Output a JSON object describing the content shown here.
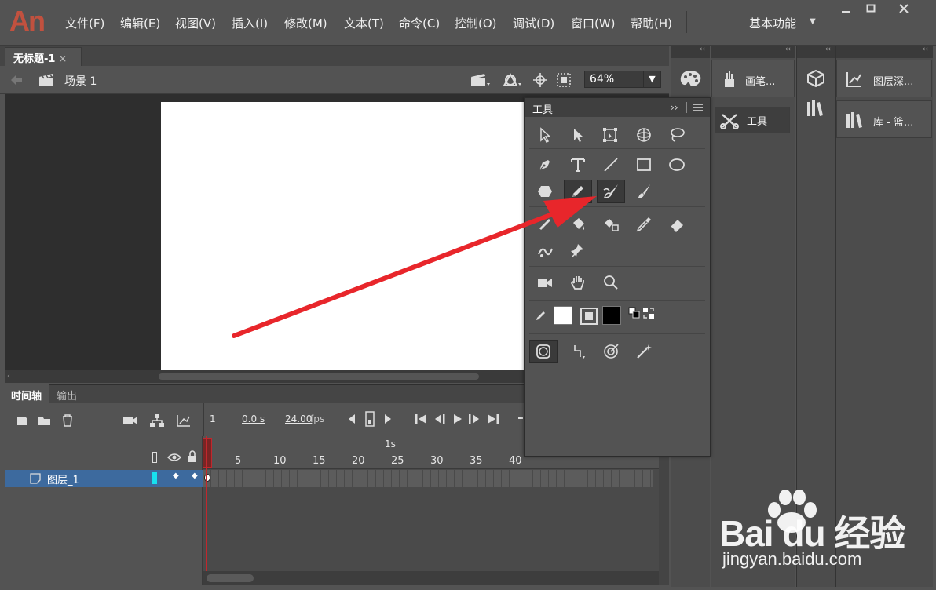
{
  "app": {
    "logo": "An",
    "workspace": "基本功能"
  },
  "menu": [
    "文件(F)",
    "编辑(E)",
    "视图(V)",
    "插入(I)",
    "修改(M)",
    "文本(T)",
    "命令(C)",
    "控制(O)",
    "调试(D)",
    "窗口(W)",
    "帮助(H)"
  ],
  "document": {
    "tab_title": "无标题-1",
    "close": "×",
    "scene": "场景 1",
    "zoom": "64%"
  },
  "timeline": {
    "tab_timeline": "时间轴",
    "tab_output": "输出",
    "current_frame": "1",
    "time": "0.0 s",
    "fps": "24.00",
    "fps_unit": "fps",
    "ruler_marker": "1s",
    "ruler": [
      "1",
      "5",
      "10",
      "15",
      "20",
      "25",
      "30",
      "35",
      "40"
    ],
    "layer_name": "图层_1"
  },
  "panels": {
    "brush_lib": "画笔...",
    "tools": "工具",
    "layer_depth": "图层深...",
    "library": "库 - 篮...",
    "collapse": "‹‹"
  },
  "tools_panel": {
    "title": "工具",
    "expand": "››"
  },
  "colors": {
    "stroke": "#ffffff",
    "fill": "#000000",
    "accent": "#c1272d",
    "layer_highlight": "#3d6a9e"
  },
  "watermark": {
    "logo": "Bai du 经验",
    "url": "jingyan.baidu.com"
  }
}
